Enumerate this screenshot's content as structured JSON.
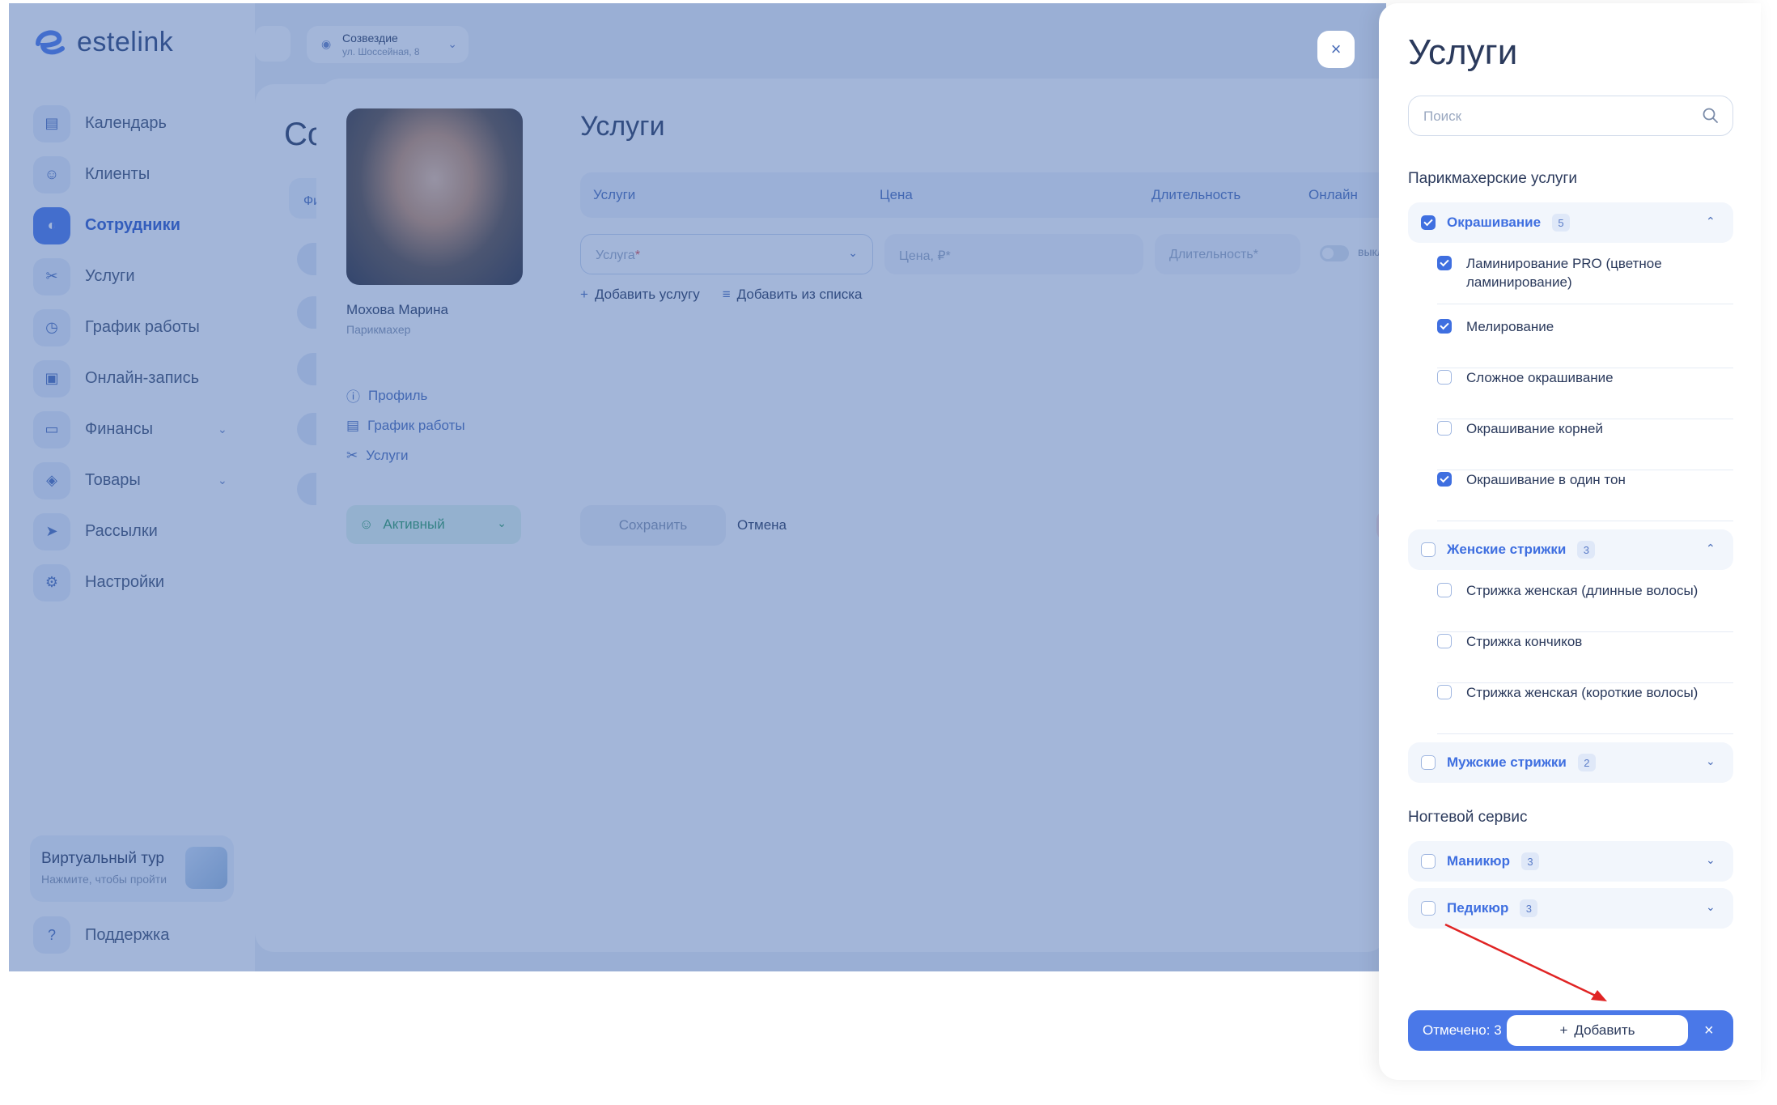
{
  "app": {
    "brand": "estelink",
    "location": {
      "name": "Созвездие",
      "address": "ул. Шоссейная, 8"
    }
  },
  "sidebar": {
    "items": [
      {
        "label": "Календарь",
        "icon": "calendar-icon"
      },
      {
        "label": "Клиенты",
        "icon": "users-icon"
      },
      {
        "label": "Сотрудники",
        "icon": "user-icon",
        "active": true
      },
      {
        "label": "Услуги",
        "icon": "scissors-icon"
      },
      {
        "label": "График работы",
        "icon": "clock-icon"
      },
      {
        "label": "Онлайн-запись",
        "icon": "booking-icon"
      },
      {
        "label": "Финансы",
        "icon": "wallet-icon",
        "expandable": true
      },
      {
        "label": "Товары",
        "icon": "box-icon",
        "expandable": true
      },
      {
        "label": "Рассылки",
        "icon": "send-icon"
      },
      {
        "label": "Настройки",
        "icon": "gear-icon"
      }
    ],
    "virtual_tour": {
      "title": "Виртуальный тур",
      "subtitle": "Нажмите, чтобы пройти"
    },
    "support": "Поддержка"
  },
  "background": {
    "title_fragment": "Со",
    "column_fragment": "Фи"
  },
  "employee": {
    "name": "Мохова Марина",
    "role": "Парикмахер",
    "menu": [
      "Профиль",
      "График работы",
      "Услуги"
    ],
    "status": "Активный"
  },
  "services_form": {
    "title": "Услуги",
    "headers": {
      "service": "Услуги",
      "price": "Цена",
      "duration": "Длительность",
      "online": "Онлайн"
    },
    "service_placeholder": "Услуга",
    "price_placeholder": "Цена, ₽",
    "duration_placeholder": "Длительность",
    "required_mark": "*",
    "toggle_label": "выкл",
    "add_service": "Добавить услугу",
    "add_from_list": "Добавить из списка",
    "save": "Сохранить",
    "cancel": "Отмена"
  },
  "panel": {
    "title": "Услуги",
    "search_placeholder": "Поиск",
    "categories": [
      {
        "title": "Парикмахерские услуги",
        "groups": [
          {
            "label": "Окрашивание",
            "count": "5",
            "checked": true,
            "expanded": true,
            "items": [
              {
                "label": "Ламинирование PRO (цветное ламинирование)",
                "checked": true
              },
              {
                "label": "Мелирование",
                "checked": true
              },
              {
                "label": "Сложное окрашивание",
                "checked": false
              },
              {
                "label": "Окрашивание корней",
                "checked": false
              },
              {
                "label": "Окрашивание в один тон",
                "checked": true
              }
            ]
          },
          {
            "label": "Женские стрижки",
            "count": "3",
            "checked": false,
            "expanded": true,
            "items": [
              {
                "label": "Стрижка женская (длинные волосы)",
                "checked": false
              },
              {
                "label": "Стрижка кончиков",
                "checked": false
              },
              {
                "label": "Стрижка женская (короткие волосы)",
                "checked": false
              }
            ]
          },
          {
            "label": "Мужские стрижки",
            "count": "2",
            "checked": false,
            "expanded": false,
            "items": []
          }
        ]
      },
      {
        "title": "Ногтевой сервис",
        "groups": [
          {
            "label": "Маникюр",
            "count": "3",
            "checked": false,
            "expanded": false,
            "items": []
          },
          {
            "label": "Педикюр",
            "count": "3",
            "checked": false,
            "expanded": false,
            "items": []
          }
        ]
      }
    ],
    "selected_count": "Отмечено: 3",
    "add_button": "Добавить"
  },
  "colors": {
    "accent": "#4a78e8",
    "overlay": "#3c64af",
    "arrow": "#e02424",
    "active_status": "#2e9e63"
  }
}
